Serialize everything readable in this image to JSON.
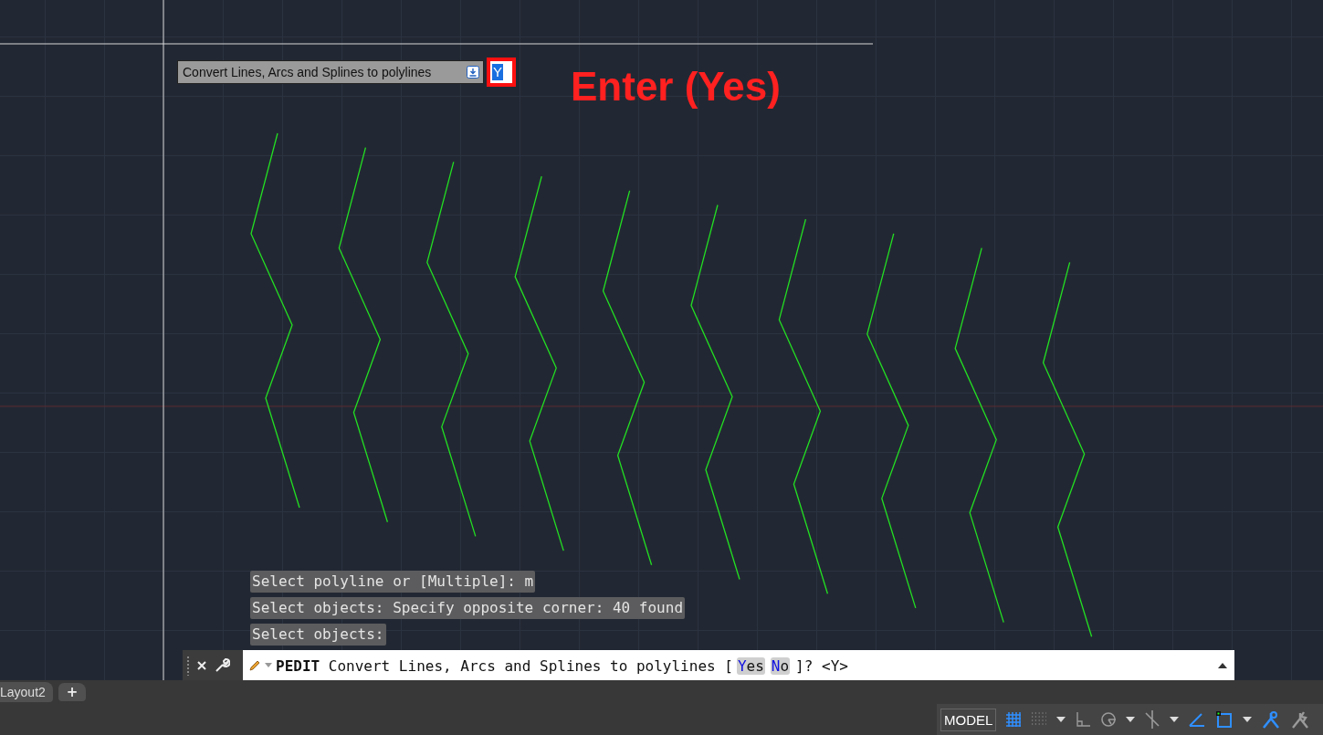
{
  "tooltip": {
    "text": "Convert Lines, Arcs and Splines to polylines",
    "input": "Y"
  },
  "annotation": "Enter (Yes)",
  "history": [
    "Select polyline or [Multiple]: m",
    "Select objects: Specify opposite corner: 40 found",
    "Select objects:"
  ],
  "command_line": {
    "command": "PEDIT",
    "prompt": "Convert Lines, Arcs and Splines to polylines [",
    "options": [
      {
        "key": "Y",
        "rest": "es"
      },
      {
        "key": "N",
        "rest": "o"
      }
    ],
    "suffix": "]? <Y>"
  },
  "layout_tabs": [
    {
      "label": "Layout2"
    }
  ],
  "add_tab": "+",
  "status_bar": {
    "model": "MODEL",
    "toggles": [
      {
        "kind": "grid",
        "on": true
      },
      {
        "kind": "snap",
        "on": false
      },
      {
        "kind": "caret"
      },
      {
        "kind": "ortho",
        "on": false
      },
      {
        "kind": "polar",
        "on": false
      },
      {
        "kind": "caret"
      },
      {
        "kind": "isodraft",
        "on": false
      },
      {
        "kind": "caret"
      },
      {
        "kind": "tracking",
        "on": true
      },
      {
        "kind": "osnap",
        "on": true
      },
      {
        "kind": "caret"
      },
      {
        "kind": "annovis",
        "on": true
      },
      {
        "kind": "autoscale",
        "on": false
      }
    ]
  }
}
